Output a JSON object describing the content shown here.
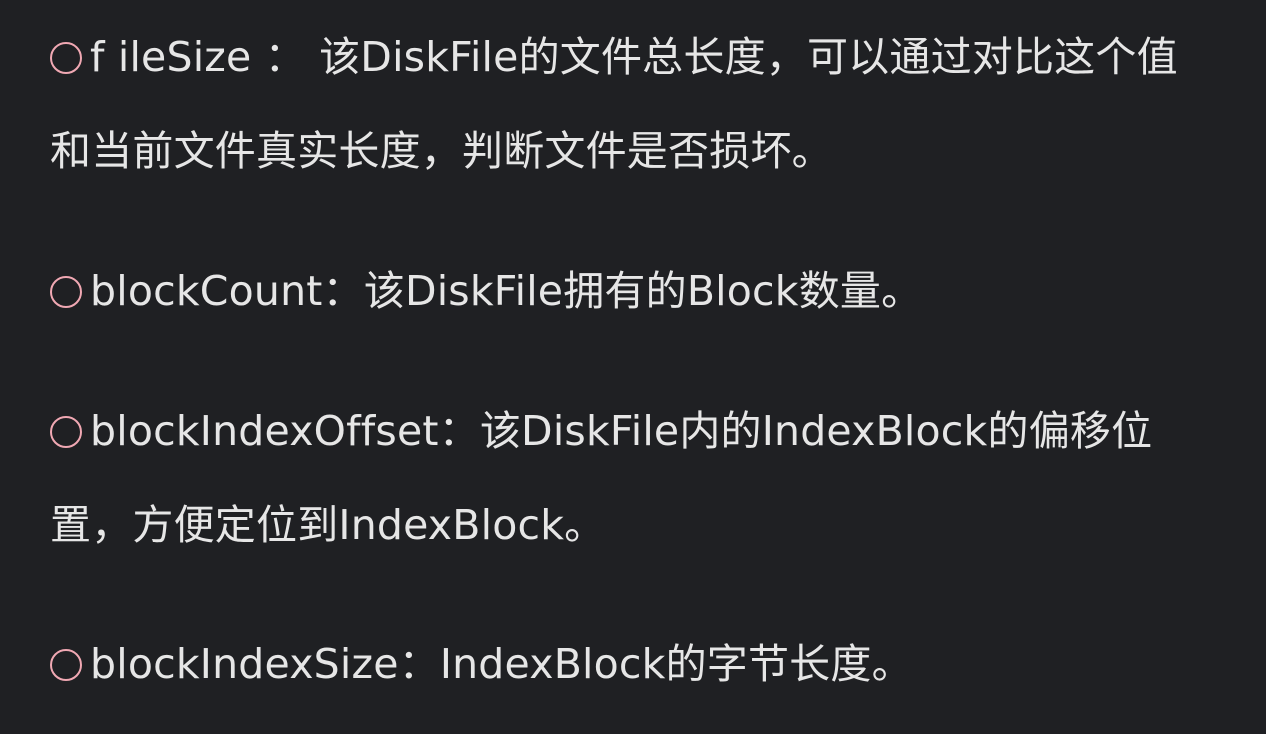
{
  "items": [
    {
      "text": "f ileSize ： 该DiskFile的文件总长度，可以通过对比这个值和当前文件真实长度，判断文件是否损坏。"
    },
    {
      "text": "blockCount：该DiskFile拥有的Block数量。"
    },
    {
      "text": "blockIndexOffset：该DiskFile内的IndexBlock的偏移位置，方便定位到IndexBlock。"
    },
    {
      "text": "blockIndexSize：IndexBlock的字节长度。"
    }
  ],
  "colors": {
    "background": "#1f2023",
    "text": "#e6e6e6",
    "bullet": "#f0a8b3"
  }
}
